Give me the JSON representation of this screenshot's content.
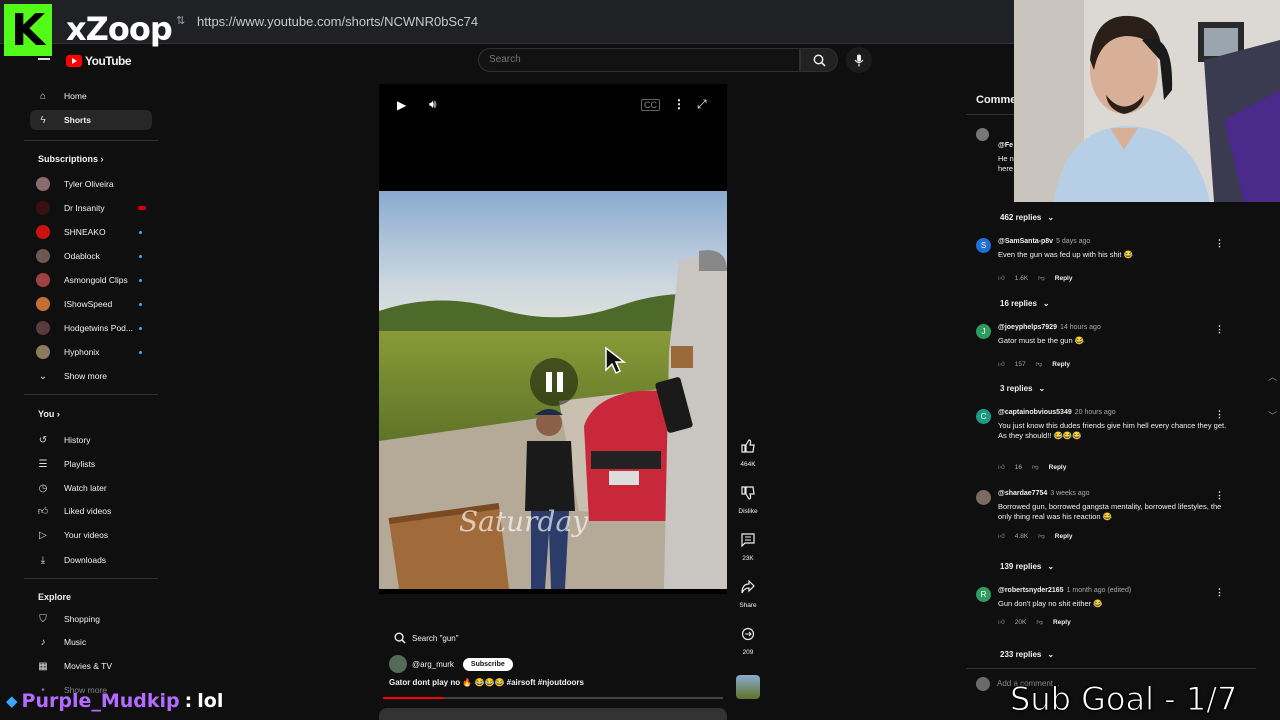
{
  "browser": {
    "url": "https://www.youtube.com/shorts/NCWNR0bSc74"
  },
  "overlay": {
    "logo_letter": "K",
    "logo_text": "xZoop",
    "chat_user": "Purple_Mudkip",
    "chat_sep": ":",
    "chat_msg": "lol",
    "sub_goal": "Sub Goal - 1/7"
  },
  "header": {
    "logo_text": "YouTube",
    "search_placeholder": "Search"
  },
  "sidebar": {
    "main": [
      {
        "label": "Home",
        "icon": "home-icon"
      },
      {
        "label": "Shorts",
        "icon": "shorts-icon",
        "active": true
      }
    ],
    "subscriptions_heading": "Subscriptions",
    "subscriptions": [
      {
        "label": "Tyler Oliveira",
        "color": "#8a6a6a",
        "dot": false
      },
      {
        "label": "Dr Insanity",
        "color": "#3a1010",
        "dot": false,
        "live": true
      },
      {
        "label": "SHNEAKO",
        "color": "#cc1111",
        "dot": true
      },
      {
        "label": "Odablock",
        "color": "#6a5a50",
        "dot": true
      },
      {
        "label": "Asmongold Clips",
        "color": "#a04040",
        "dot": true
      },
      {
        "label": "IShowSpeed",
        "color": "#c07030",
        "dot": true
      },
      {
        "label": "Hodgetwins Pod...",
        "color": "#5a3a3a",
        "dot": true
      },
      {
        "label": "Hyphonix",
        "color": "#8a7a60",
        "dot": true
      }
    ],
    "show_more": "Show more",
    "you_heading": "You",
    "you": [
      {
        "label": "History",
        "icon": "history-icon"
      },
      {
        "label": "Playlists",
        "icon": "playlists-icon"
      },
      {
        "label": "Watch later",
        "icon": "watch-later-icon"
      },
      {
        "label": "Liked videos",
        "icon": "liked-videos-icon"
      },
      {
        "label": "Your videos",
        "icon": "your-videos-icon"
      },
      {
        "label": "Downloads",
        "icon": "downloads-icon"
      }
    ],
    "explore_heading": "Explore",
    "explore": [
      {
        "label": "Shopping",
        "icon": "shopping-icon"
      },
      {
        "label": "Music",
        "icon": "music-icon"
      },
      {
        "label": "Movies & TV",
        "icon": "movies-icon"
      }
    ],
    "partial_item": "Show more"
  },
  "short": {
    "search_chip": "Search \"gun\"",
    "channel": "@arg_murk",
    "subscribe": "Subscribe",
    "caption": "Gator dont play no 🔥 😂😂😂 #airsoft #njoutdoors",
    "watermark": "Saturday",
    "progress": 0.18
  },
  "actions": {
    "likes": "464K",
    "dislike": "Dislike",
    "comments": "23K",
    "share": "Share",
    "remix": "209"
  },
  "comments": {
    "title": "Comme",
    "partial_handle": "@Fe",
    "partial_text": "He n",
    "partial_text2": "here",
    "replies_top": "462 replies",
    "items": [
      {
        "user": "@SamSanta-p8v",
        "time": "5 days ago",
        "text": "Even the gun was fed up with his shit 😂",
        "likes": "1.6K",
        "replies": "16 replies",
        "avatar": "S",
        "color": "#1f6fd6"
      },
      {
        "user": "@joeyphelps7929",
        "time": "14 hours ago",
        "text": "Gator must be the gun 😂",
        "likes": "157",
        "replies": "3 replies",
        "avatar": "J",
        "color": "#2e9c5e"
      },
      {
        "user": "@captainobvious5349",
        "time": "20 hours ago",
        "text": "You just know this dudes friends give him hell every chance they get. As they should!! 😂😂😂",
        "likes": "16",
        "replies": "139 replies",
        "avatar": "C",
        "color": "#1a9c83"
      },
      {
        "user": "@shardae7754",
        "time": "3 weeks ago",
        "text": "Borrowed gun, borrowed gangsta mentality, borrowed lifestyles, the only thing real was his reaction 😂",
        "likes": "4.8K",
        "replies": "233 replies",
        "avatar": "",
        "color": "#7a6a60"
      },
      {
        "user": "@robertsnyder2165",
        "time": "1 month ago (edited)",
        "text": "Gun don't play no shit either 😂",
        "likes": "20K",
        "replies": "",
        "avatar": "R",
        "color": "#2e9c5e"
      }
    ],
    "reply_label": "Reply",
    "add_placeholder": "Add a comment..."
  }
}
